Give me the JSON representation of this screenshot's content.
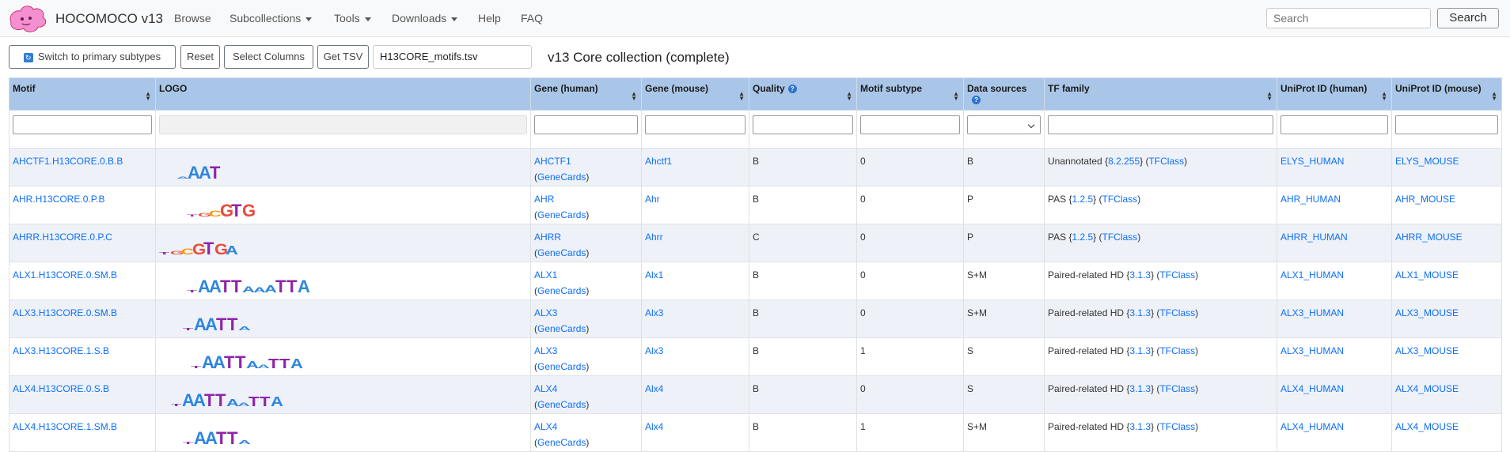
{
  "nav": {
    "brand": "HOCOMOCO v13",
    "items": [
      {
        "label": "Browse",
        "dropdown": false
      },
      {
        "label": "Subcollections",
        "dropdown": true
      },
      {
        "label": "Tools",
        "dropdown": true
      },
      {
        "label": "Downloads",
        "dropdown": true
      },
      {
        "label": "Help",
        "dropdown": false
      },
      {
        "label": "FAQ",
        "dropdown": false
      }
    ],
    "search_placeholder": "Search",
    "search_button": "Search"
  },
  "toolbar": {
    "switch_label": "Switch to primary subtypes",
    "reset_label": "Reset",
    "select_columns_label": "Select Columns",
    "get_tsv_label": "Get TSV",
    "filename": "H13CORE_motifs.tsv",
    "page_title": "v13 Core collection (complete)"
  },
  "columns": [
    "Motif",
    "LOGO",
    "Gene (human)",
    "Gene (mouse)",
    "Quality",
    "Motif subtype",
    "Data sources",
    "TF family",
    "UniProt ID (human)",
    "UniProt ID (mouse)"
  ],
  "genecards_label": "GeneCards",
  "tfclass_label": "TFClass",
  "rows": [
    {
      "motif": "AHCTF1.H13CORE.0.B.B",
      "gene_h": "AHCTF1",
      "gene_m": "Ahctf1",
      "quality": "B",
      "subtype": "0",
      "sources": "B",
      "family": "Unannotated",
      "family_code": "8.2.255",
      "uniprot_h": "ELYS_HUMAN",
      "uniprot_m": "ELYS_MOUSE",
      "logo": "AAAT"
    },
    {
      "motif": "AHR.H13CORE.0.P.B",
      "gene_h": "AHR",
      "gene_m": "Ahr",
      "quality": "B",
      "subtype": "0",
      "sources": "P",
      "family": "PAS",
      "family_code": "1.2.5",
      "uniprot_h": "AHR_HUMAN",
      "uniprot_m": "AHR_MOUSE",
      "logo": "TGCGTG"
    },
    {
      "motif": "AHRR.H13CORE.0.P.C",
      "gene_h": "AHRR",
      "gene_m": "Ahrr",
      "quality": "C",
      "subtype": "0",
      "sources": "P",
      "family": "PAS",
      "family_code": "1.2.5",
      "uniprot_h": "AHRR_HUMAN",
      "uniprot_m": "AHRR_MOUSE",
      "logo": "TGCGTGA"
    },
    {
      "motif": "ALX1.H13CORE.0.SM.B",
      "gene_h": "ALX1",
      "gene_m": "Alx1",
      "quality": "B",
      "subtype": "0",
      "sources": "S+M",
      "family": "Paired-related HD",
      "family_code": "3.1.3",
      "uniprot_h": "ALX1_HUMAN",
      "uniprot_m": "ALX1_MOUSE",
      "logo": "TAATTAAATTA"
    },
    {
      "motif": "ALX3.H13CORE.0.SM.B",
      "gene_h": "ALX3",
      "gene_m": "Alx3",
      "quality": "B",
      "subtype": "0",
      "sources": "S+M",
      "family": "Paired-related HD",
      "family_code": "3.1.3",
      "uniprot_h": "ALX3_HUMAN",
      "uniprot_m": "ALX3_MOUSE",
      "logo": "TAATTA"
    },
    {
      "motif": "ALX3.H13CORE.1.S.B",
      "gene_h": "ALX3",
      "gene_m": "Alx3",
      "quality": "B",
      "subtype": "1",
      "sources": "S",
      "family": "Paired-related HD",
      "family_code": "3.1.3",
      "uniprot_h": "ALX3_HUMAN",
      "uniprot_m": "ALX3_MOUSE",
      "logo": "TAATTAATTA"
    },
    {
      "motif": "ALX4.H13CORE.0.S.B",
      "gene_h": "ALX4",
      "gene_m": "Alx4",
      "quality": "B",
      "subtype": "0",
      "sources": "S",
      "family": "Paired-related HD",
      "family_code": "3.1.3",
      "uniprot_h": "ALX4_HUMAN",
      "uniprot_m": "ALX4_MOUSE",
      "logo": "TAATTAATTA"
    },
    {
      "motif": "ALX4.H13CORE.1.SM.B",
      "gene_h": "ALX4",
      "gene_m": "Alx4",
      "quality": "B",
      "subtype": "1",
      "sources": "S+M",
      "family": "Paired-related HD",
      "family_code": "3.1.3",
      "uniprot_h": "ALX4_HUMAN",
      "uniprot_m": "ALX4_MOUSE",
      "logo": "TAATTA"
    }
  ],
  "colors": {
    "header_bg": "#a9c6e8",
    "link": "#0d6efd",
    "row_alt": "#eef2f8",
    "A": "#2e86de",
    "C": "#f39c12",
    "G": "#e74c3c",
    "T": "#8e24aa"
  }
}
